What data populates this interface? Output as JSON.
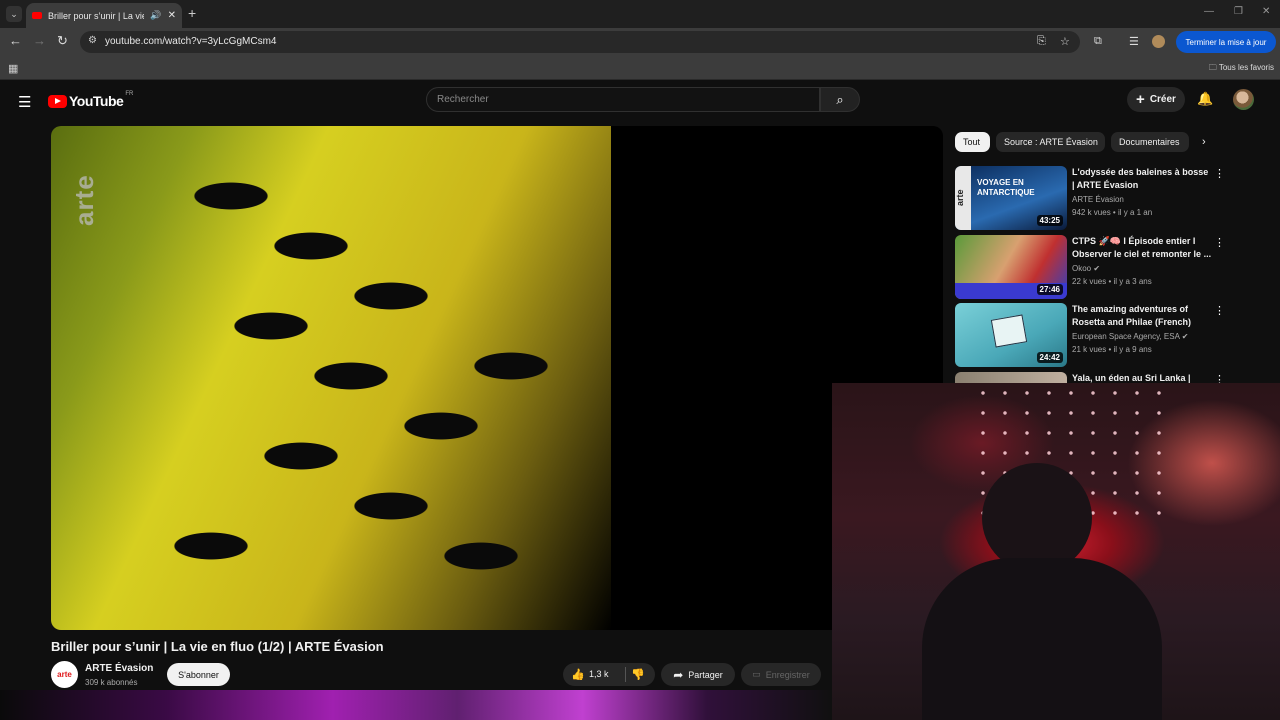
{
  "browser": {
    "tab_title": "Briller pour s’unir | La vie en fluo",
    "tab_sound": "🔊",
    "tab_close": "✕",
    "new_tab": "+",
    "url": "youtube.com/watch?v=3yLcGgMCsm4",
    "update_label": "Terminer la mise à jour",
    "bookmarks_all": "Tous les favoris"
  },
  "youtube": {
    "logo_text": "YouTube",
    "region": "FR",
    "search_placeholder": "Rechercher",
    "create_label": "Créer"
  },
  "video": {
    "watermark": "arte",
    "title": "Briller pour s’unir | La vie en fluo (1/2) | ARTE Évasion",
    "channel": "ARTE Évasion",
    "channel_logo_text": "arte",
    "subscribers": "309 k abonnés",
    "subscribe_label": "S'abonner",
    "likes": "1,3 k",
    "share_label": "Partager",
    "save_label": "Enregistrer"
  },
  "chips": [
    "Tout",
    "Source : ARTE Évasion",
    "Documentaires"
  ],
  "recommendations": [
    {
      "title": "L'odyssée des baleines à bosse | ARTE Évasion",
      "channel": "ARTE Évasion",
      "meta": "942 k vues • il y a 1 an",
      "duration": "43:25",
      "thumb_text": "VOYAGE EN ANTARCTIQUE"
    },
    {
      "title": "CTPS 🚀🧠 I Épisode entier I Observer le ciel et remonter le ...",
      "channel": "Okoo ✔",
      "meta": "22 k vues • il y a 3 ans",
      "duration": "27:46"
    },
    {
      "title": "The amazing adventures of Rosetta and Philae (French)",
      "channel": "European Space Agency, ESA ✔",
      "meta": "21 k vues • il y a 9 ans",
      "duration": "24:42"
    },
    {
      "title": "Yala, un éden au Sri Lanka |",
      "channel": "",
      "meta": "",
      "duration": ""
    }
  ]
}
